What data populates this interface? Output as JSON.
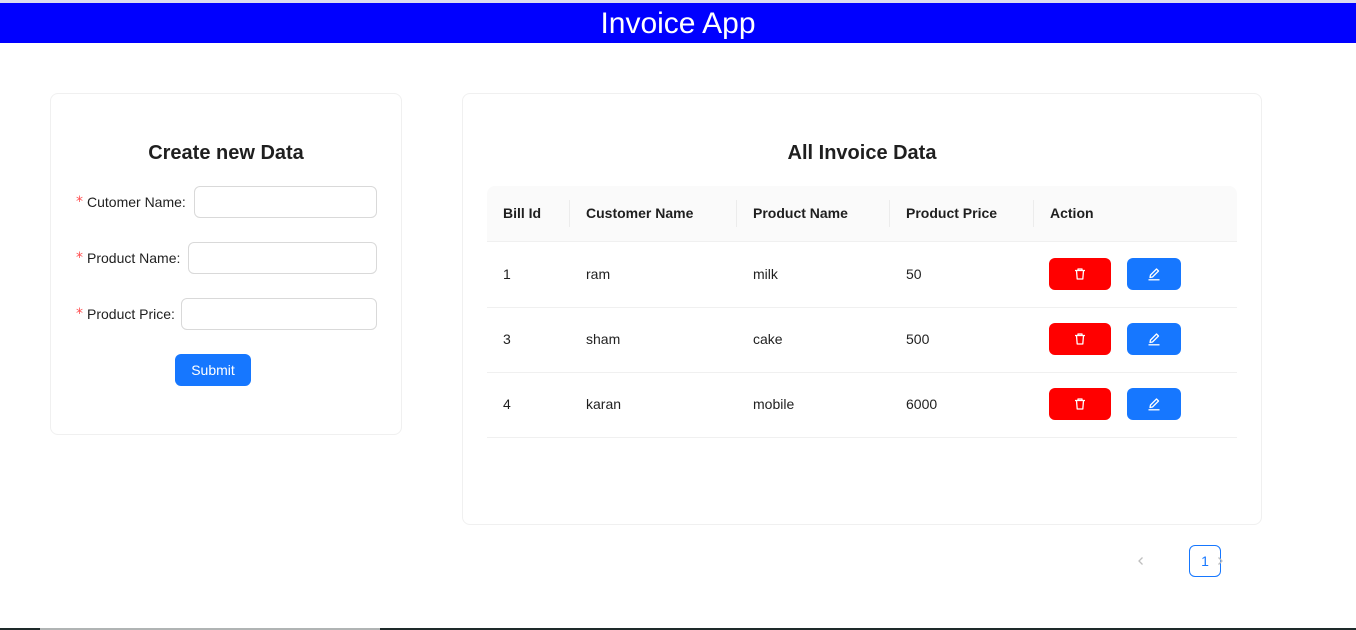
{
  "app": {
    "title": "Invoice App"
  },
  "form": {
    "title": "Create new Data",
    "required_mark": "*",
    "fields": [
      {
        "label": "Cutomer Name",
        "value": ""
      },
      {
        "label": "Product Name",
        "value": ""
      },
      {
        "label": "Product Price",
        "value": ""
      }
    ],
    "submit_label": "Submit"
  },
  "table": {
    "title": "All Invoice Data",
    "columns": [
      "Bill Id",
      "Customer Name",
      "Product Name",
      "Product Price",
      "Action"
    ],
    "rows": [
      {
        "bill_id": "1",
        "customer": "ram",
        "product": "milk",
        "price": "50"
      },
      {
        "bill_id": "3",
        "customer": "sham",
        "product": "cake",
        "price": "500"
      },
      {
        "bill_id": "4",
        "customer": "karan",
        "product": "mobile",
        "price": "6000"
      }
    ],
    "action_icons": [
      "trash-icon",
      "edit-pencil-icon"
    ]
  },
  "pagination": {
    "current_page": "1"
  },
  "colors": {
    "header": "#0000ff",
    "delete": "#ff0000",
    "primary": "#1677ff"
  }
}
